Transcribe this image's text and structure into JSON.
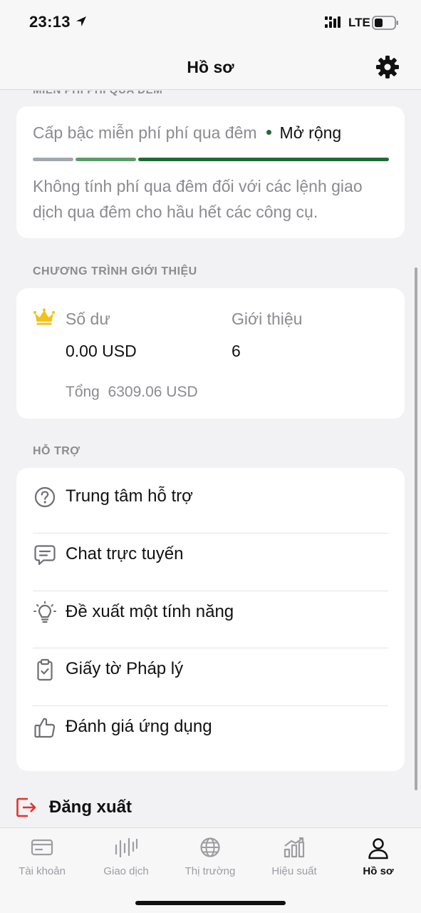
{
  "status_bar": {
    "time": "23:13",
    "network": "LTE"
  },
  "header": {
    "title": "Hồ sơ"
  },
  "overnight": {
    "section_label_partial": "MIỄN PHÍ PHÍ QUA ĐÊM",
    "tier_label": "Cấp bậc miễn phí phí qua đêm",
    "tier_value": "Mở rộng",
    "description": "Không tính phí qua đêm đối với các lệnh giao dịch qua đêm cho hầu hết các công cụ."
  },
  "referral": {
    "section_label": "CHƯƠNG TRÌNH GIỚI THIỆU",
    "balance_label": "Số dư",
    "balance_value": "0.00 USD",
    "referrals_label": "Giới thiệu",
    "referrals_value": "6",
    "total_label": "Tổng",
    "total_value": "6309.06 USD"
  },
  "support": {
    "section_label": "HỖ TRỢ",
    "items": [
      {
        "label": "Trung tâm hỗ trợ",
        "icon": "question-circle-icon"
      },
      {
        "label": "Chat trực tuyến",
        "icon": "chat-bubble-icon"
      },
      {
        "label": "Đề xuất một tính năng",
        "icon": "lightbulb-icon"
      },
      {
        "label": "Giấy tờ Pháp lý",
        "icon": "clipboard-check-icon"
      },
      {
        "label": "Đánh giá ứng dụng",
        "icon": "thumbs-up-icon"
      }
    ]
  },
  "logout": {
    "label": "Đăng xuất"
  },
  "tabs": [
    {
      "label": "Tài khoản",
      "icon": "card-icon",
      "active": false
    },
    {
      "label": "Giao dịch",
      "icon": "candles-icon",
      "active": false
    },
    {
      "label": "Thị trường",
      "icon": "globe-icon",
      "active": false
    },
    {
      "label": "Hiệu suất",
      "icon": "performance-chart-icon",
      "active": false
    },
    {
      "label": "Hồ sơ",
      "icon": "person-icon",
      "active": true
    }
  ],
  "colors": {
    "accent_green": "#1e6b35",
    "mid_green": "#5a9e67",
    "inactive_gray": "#a3a7ae",
    "crown_gold": "#f2c21b",
    "logout_red": "#e5332a"
  }
}
